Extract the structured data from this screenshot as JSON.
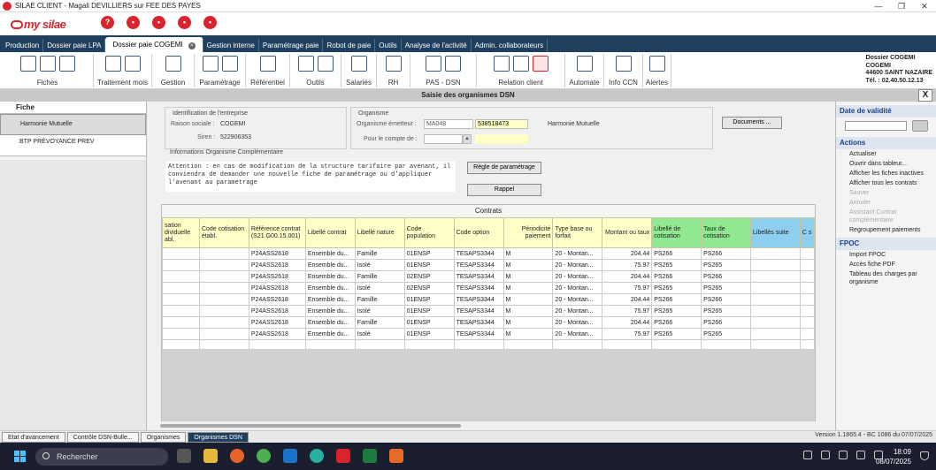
{
  "window": {
    "title": "SILAE CLIENT - Magali DEVILLIERS sur FEE DES PAYES"
  },
  "logo": {
    "text": "my silae"
  },
  "module_tabs": [
    "Production",
    "Dossier paie LPA",
    "Dossier paie COGEMI",
    "Gestion interne",
    "Paramétrage paie",
    "Robot de paie",
    "Outils",
    "Analyse de l'activité",
    "Admin. collaborateurs"
  ],
  "active_module_tab": "Dossier paie COGEMI",
  "ribbon": [
    {
      "label": "Fiches",
      "w": 104
    },
    {
      "label": "Traitement mois",
      "w": 66
    },
    {
      "label": "Gestion",
      "w": 48
    },
    {
      "label": "Paramétrage",
      "w": 58
    },
    {
      "label": "Référentiel",
      "w": 50
    },
    {
      "label": "Outils",
      "w": 58
    },
    {
      "label": "Salariés",
      "w": 40
    },
    {
      "label": "RH",
      "w": 38
    },
    {
      "label": "PAS - DSN",
      "w": 75
    },
    {
      "label": "Relation client",
      "w": 100
    },
    {
      "label": "Automate",
      "w": 44
    },
    {
      "label": "Info CCN",
      "w": 44
    },
    {
      "label": "Alertes",
      "w": 32
    }
  ],
  "company": {
    "line1": "Dossier COGEMI",
    "line2": "COGEMI",
    "line3": "44600 SAINT NAZAIRE",
    "line4": "Tél. : 02.40.50.12.13"
  },
  "panel": {
    "title": "Saisie des organismes DSN",
    "close": "X"
  },
  "left": {
    "header": "Fiche",
    "items": [
      {
        "label": "Harmonie Mutuelle"
      },
      {
        "label": "BTP PRÉVOYANCE PREV"
      }
    ]
  },
  "identification": {
    "title": "Identification de l'entreprise",
    "raison_label": "Raison sociale :",
    "raison_value": "COGEMI",
    "siren_label": "Siren :",
    "siren_value": "522906353"
  },
  "organisme": {
    "title": "Organisme",
    "emetteur_label": "Organisme émetteur :",
    "emetteur_code": "MA048",
    "emetteur_num": "538518473",
    "emetteur_name": "Harmonie Mutuelle",
    "compte_label": "Pour le compte de :"
  },
  "buttons": {
    "documents": "Documents ...",
    "regle": "Règle de paramétrage",
    "rappel": "Rappel"
  },
  "info": {
    "title": "Informations Organisme Complémentaire",
    "text": "Attention : en cas de modification de la structure tarifaire par avenant, il conviendra de demander une nouvelle fiche de paramétrage ou d'appliquer l'avenant au paramétrage"
  },
  "contracts": {
    "title": "Contrats",
    "headers": [
      "sation dividuelle abl.",
      "Code cotisation établ.",
      "Référence contrat (S21.G00.15.001)",
      "Libellé contrat",
      "Libellé nature",
      "Code population",
      "Code option",
      "Périodicité paiement",
      "Type base ou forfait",
      "Montant ou taux",
      "Libellé de cotisation",
      "Taux de cotisation",
      "Libellés suite",
      "C s"
    ],
    "rows": [
      [
        "",
        "",
        "P24ASS2618",
        "Ensemble du...",
        "Famille",
        "01ENSP",
        "TESAPS3344",
        "M",
        "20 - Montan...",
        "204.44",
        "PS266",
        "PS266",
        "",
        ""
      ],
      [
        "",
        "",
        "P24ASS2618",
        "Ensemble du...",
        "Isolé",
        "01ENSP",
        "TESAPS3344",
        "M",
        "20 - Montan...",
        "75.97",
        "PS265",
        "PS265",
        "",
        ""
      ],
      [
        "",
        "",
        "P24ASS2618",
        "Ensemble du...",
        "Famille",
        "02ENSP",
        "TESAPS3344",
        "M",
        "20 - Montan...",
        "204.44",
        "PS266",
        "PS266",
        "",
        ""
      ],
      [
        "",
        "",
        "P24ASS2618",
        "Ensemble du...",
        "Isolé",
        "02ENSP",
        "TESAPS3344",
        "M",
        "20 - Montan...",
        "75.97",
        "PS265",
        "PS265",
        "",
        ""
      ],
      [
        "",
        "",
        "P24ASS2618",
        "Ensemble du...",
        "Famille",
        "01ENSP",
        "TESAPS3344",
        "M",
        "20 - Montan...",
        "204.44",
        "PS266",
        "PS266",
        "",
        ""
      ],
      [
        "",
        "",
        "P24ASS2618",
        "Ensemble du...",
        "Isolé",
        "01ENSP",
        "TESAPS3344",
        "M",
        "20 - Montan...",
        "75.97",
        "PS265",
        "PS265",
        "",
        ""
      ],
      [
        "",
        "",
        "P24ASS2618",
        "Ensemble du...",
        "Famille",
        "01ENSP",
        "TESAPS3344",
        "M",
        "20 - Montan...",
        "204.44",
        "PS266",
        "PS266",
        "",
        ""
      ],
      [
        "",
        "",
        "P24ASS2618",
        "Ensemble du...",
        "Isolé",
        "01ENSP",
        "TESAPS3344",
        "M",
        "20 - Montan...",
        "75.97",
        "PS265",
        "PS265",
        "",
        ""
      ]
    ]
  },
  "right": {
    "date_header": "Date de validité",
    "actions_header": "Actions",
    "actions": [
      {
        "label": "Actualiser",
        "disabled": false
      },
      {
        "label": "Ouvrir dans tableur...",
        "disabled": false
      },
      {
        "label": "Afficher les fiches inactives",
        "disabled": false
      },
      {
        "label": "Afficher tous les contrats",
        "disabled": false
      },
      {
        "label": "Sauver",
        "disabled": true
      },
      {
        "label": "Annuler",
        "disabled": true
      },
      {
        "label": "Assistant Contrat complémentaire",
        "disabled": true
      },
      {
        "label": "Regroupement paiements",
        "disabled": false
      }
    ],
    "fpoc_header": "FPOC",
    "fpoc": [
      {
        "label": "Import FPOC"
      },
      {
        "label": "Accès fiche PDF"
      },
      {
        "label": "Tableau des charges par organisme"
      }
    ]
  },
  "bottom_tabs": [
    "Etat d'avancement",
    "Contrôle DSN-Bulle...",
    "Organismes",
    "Organismes DSN"
  ],
  "active_bottom_tab": "Organismes DSN",
  "version": "Version 1.1865.4 - BC 1086 du 07/07/2025",
  "taskbar": {
    "search": "Rechercher",
    "time": "18:09",
    "date": "08/07/2025"
  }
}
